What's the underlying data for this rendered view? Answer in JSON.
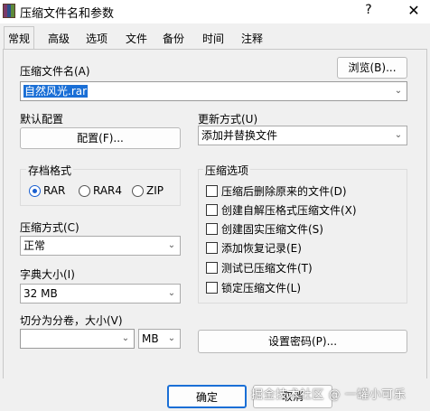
{
  "window": {
    "title": "压缩文件名和参数",
    "help": "?",
    "close": "✕"
  },
  "tabs": [
    "常规",
    "高级",
    "选项",
    "文件",
    "备份",
    "时间",
    "注释"
  ],
  "general": {
    "archive_name_label": "压缩文件名(A)",
    "browse_button": "浏览(B)...",
    "archive_name_value": "自然风光.rar",
    "default_profile_label": "默认配置",
    "profile_button": "配置(F)...",
    "update_mode_label": "更新方式(U)",
    "update_mode_value": "添加并替换文件",
    "archive_format": {
      "title": "存档格式",
      "options": [
        "RAR",
        "RAR4",
        "ZIP"
      ],
      "selected": "RAR"
    },
    "compression_method_label": "压缩方式(C)",
    "compression_method_value": "正常",
    "dictionary_size_label": "字典大小(I)",
    "dictionary_size_value": "32 MB",
    "split_label": "切分为分卷，大小(V)",
    "split_value": "",
    "split_unit": "MB",
    "options_group": {
      "title": "压缩选项",
      "items": [
        "压缩后删除原来的文件(D)",
        "创建自解压格式压缩文件(X)",
        "创建固实压缩文件(S)",
        "添加恢复记录(E)",
        "测试已压缩文件(T)",
        "锁定压缩文件(L)"
      ]
    },
    "set_password_button": "设置密码(P)..."
  },
  "footer": {
    "ok_button": "确定",
    "cancel_button": "取消",
    "watermark": "掘金技术社区 @ 一罐小可乐"
  }
}
